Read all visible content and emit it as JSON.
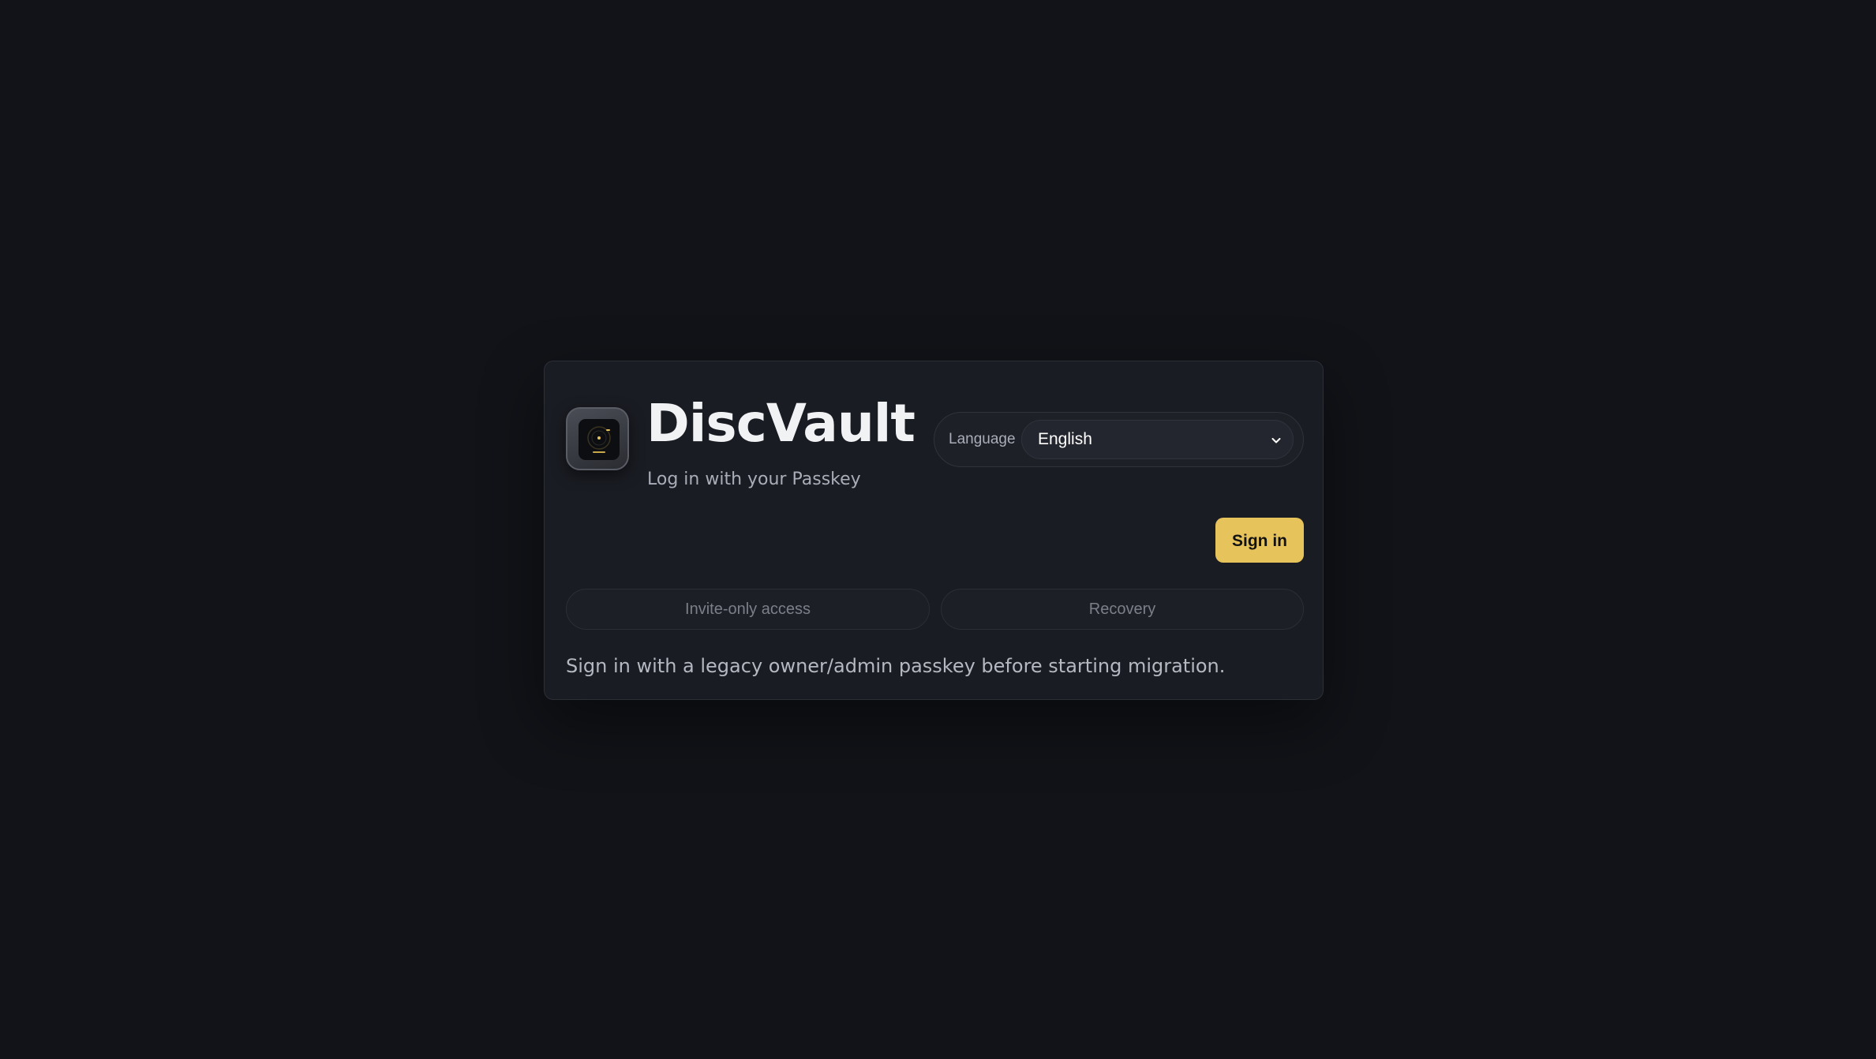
{
  "brand": {
    "name": "DiscVault",
    "subtitle": "Log in with your Passkey",
    "logo_icon": "disc-vault-logo-icon"
  },
  "language": {
    "label": "Language",
    "selected": "English",
    "dropdown_icon": "chevron-down-icon"
  },
  "actions": {
    "sign_in_label": "Sign in"
  },
  "tabs": [
    {
      "label": "Invite-only access"
    },
    {
      "label": "Recovery"
    }
  ],
  "note": "Sign in with a legacy owner/admin passkey before starting migration.",
  "colors": {
    "background": "#111318",
    "card": "#1a1c23",
    "accent": "#e7c45b"
  }
}
